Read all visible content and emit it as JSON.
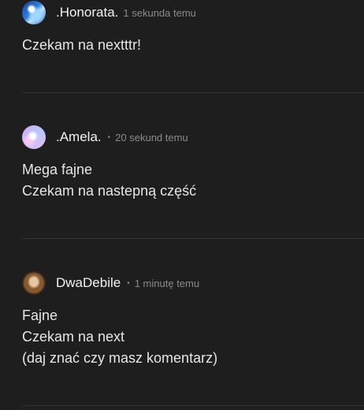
{
  "comments": [
    {
      "username": ".Honorata.",
      "time": "1 sekunda temu",
      "lines": [
        "Czekam na nextttr!"
      ]
    },
    {
      "username": ".Amela.",
      "time": "20 sekund temu",
      "lines": [
        "Mega fajne",
        "Czekam na nastepną część"
      ]
    },
    {
      "username": "DwaDebile",
      "time": "1 minutę temu",
      "lines": [
        "Fajne",
        "Czekam na next",
        "(daj znać czy masz komentarz)"
      ]
    }
  ],
  "separator": "•",
  "icons": {
    "avatar1": "avatar-image",
    "avatar2": "avatar-image",
    "avatar3": "avatar-image"
  }
}
